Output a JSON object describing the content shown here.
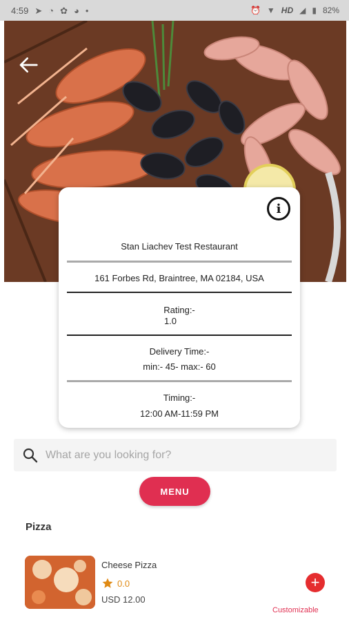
{
  "status_bar": {
    "time": "4:59",
    "network": "HD",
    "battery": "82%"
  },
  "hero": {
    "back_icon": "arrow-left-icon"
  },
  "restaurant": {
    "name": "Stan Liachev Test Restaurant",
    "address": "161 Forbes Rd, Braintree, MA 02184, USA",
    "rating_label": "Rating:-",
    "rating_value": "1.0",
    "delivery_label": "Delivery Time:-",
    "delivery_value": "min:- 45- max:- 60",
    "timing_label": "Timing:-",
    "timing_value": "12:00 AM-11:59 PM",
    "info_icon": "info-icon"
  },
  "search": {
    "placeholder": "What are you looking for?",
    "value": ""
  },
  "menu_button": {
    "label": "MENU",
    "color": "#e02f51"
  },
  "categories": [
    {
      "title": "Pizza",
      "items": [
        {
          "name": "Cheese Pizza",
          "rating": "0.0",
          "price": "USD 12.00",
          "tag": "Customizable"
        }
      ]
    }
  ],
  "colors": {
    "accent": "#e02f51",
    "star": "#e08a14",
    "add_button": "#e52d2f"
  }
}
